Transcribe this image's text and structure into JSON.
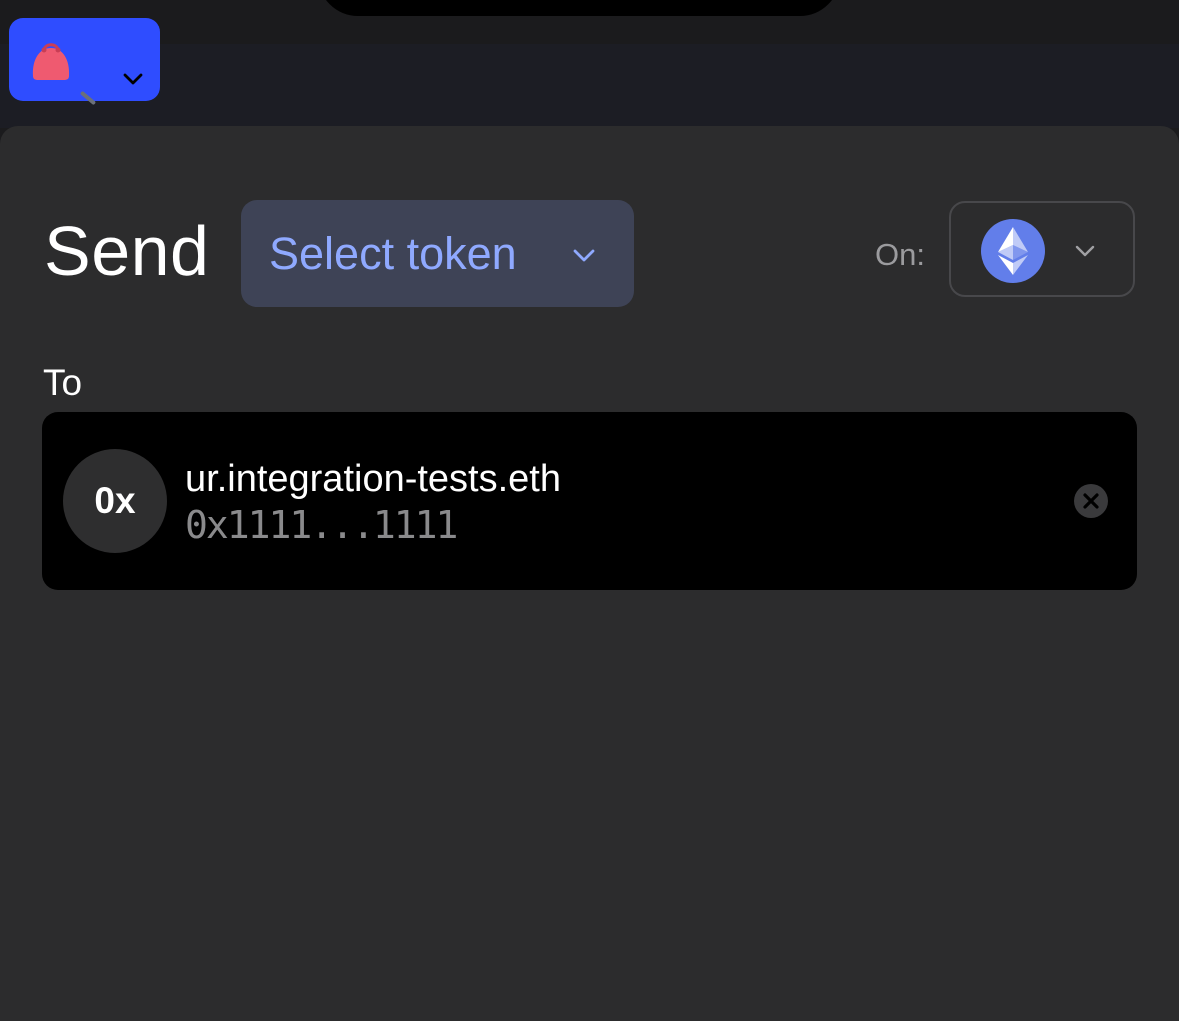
{
  "wallet": {
    "icon": "wallet-purse-icon",
    "menu_icon": "chevron-down-icon",
    "accent_color": "#2f4dff"
  },
  "send": {
    "title": "Send",
    "token_select": {
      "label": "Select token",
      "icon": "chevron-down-icon"
    },
    "network": {
      "label": "On:",
      "selected_icon": "ethereum-icon",
      "icon": "chevron-down-icon"
    }
  },
  "recipient": {
    "label": "To",
    "avatar_text": "0x",
    "name": "ur.integration-tests.eth",
    "address": "0x1111...1111",
    "clear_icon": "close-circle-icon"
  },
  "colors": {
    "background": "#2c2c2d",
    "token_button": "#3e4356",
    "token_text": "#8fa9ff",
    "ethereum": "#627eea"
  }
}
